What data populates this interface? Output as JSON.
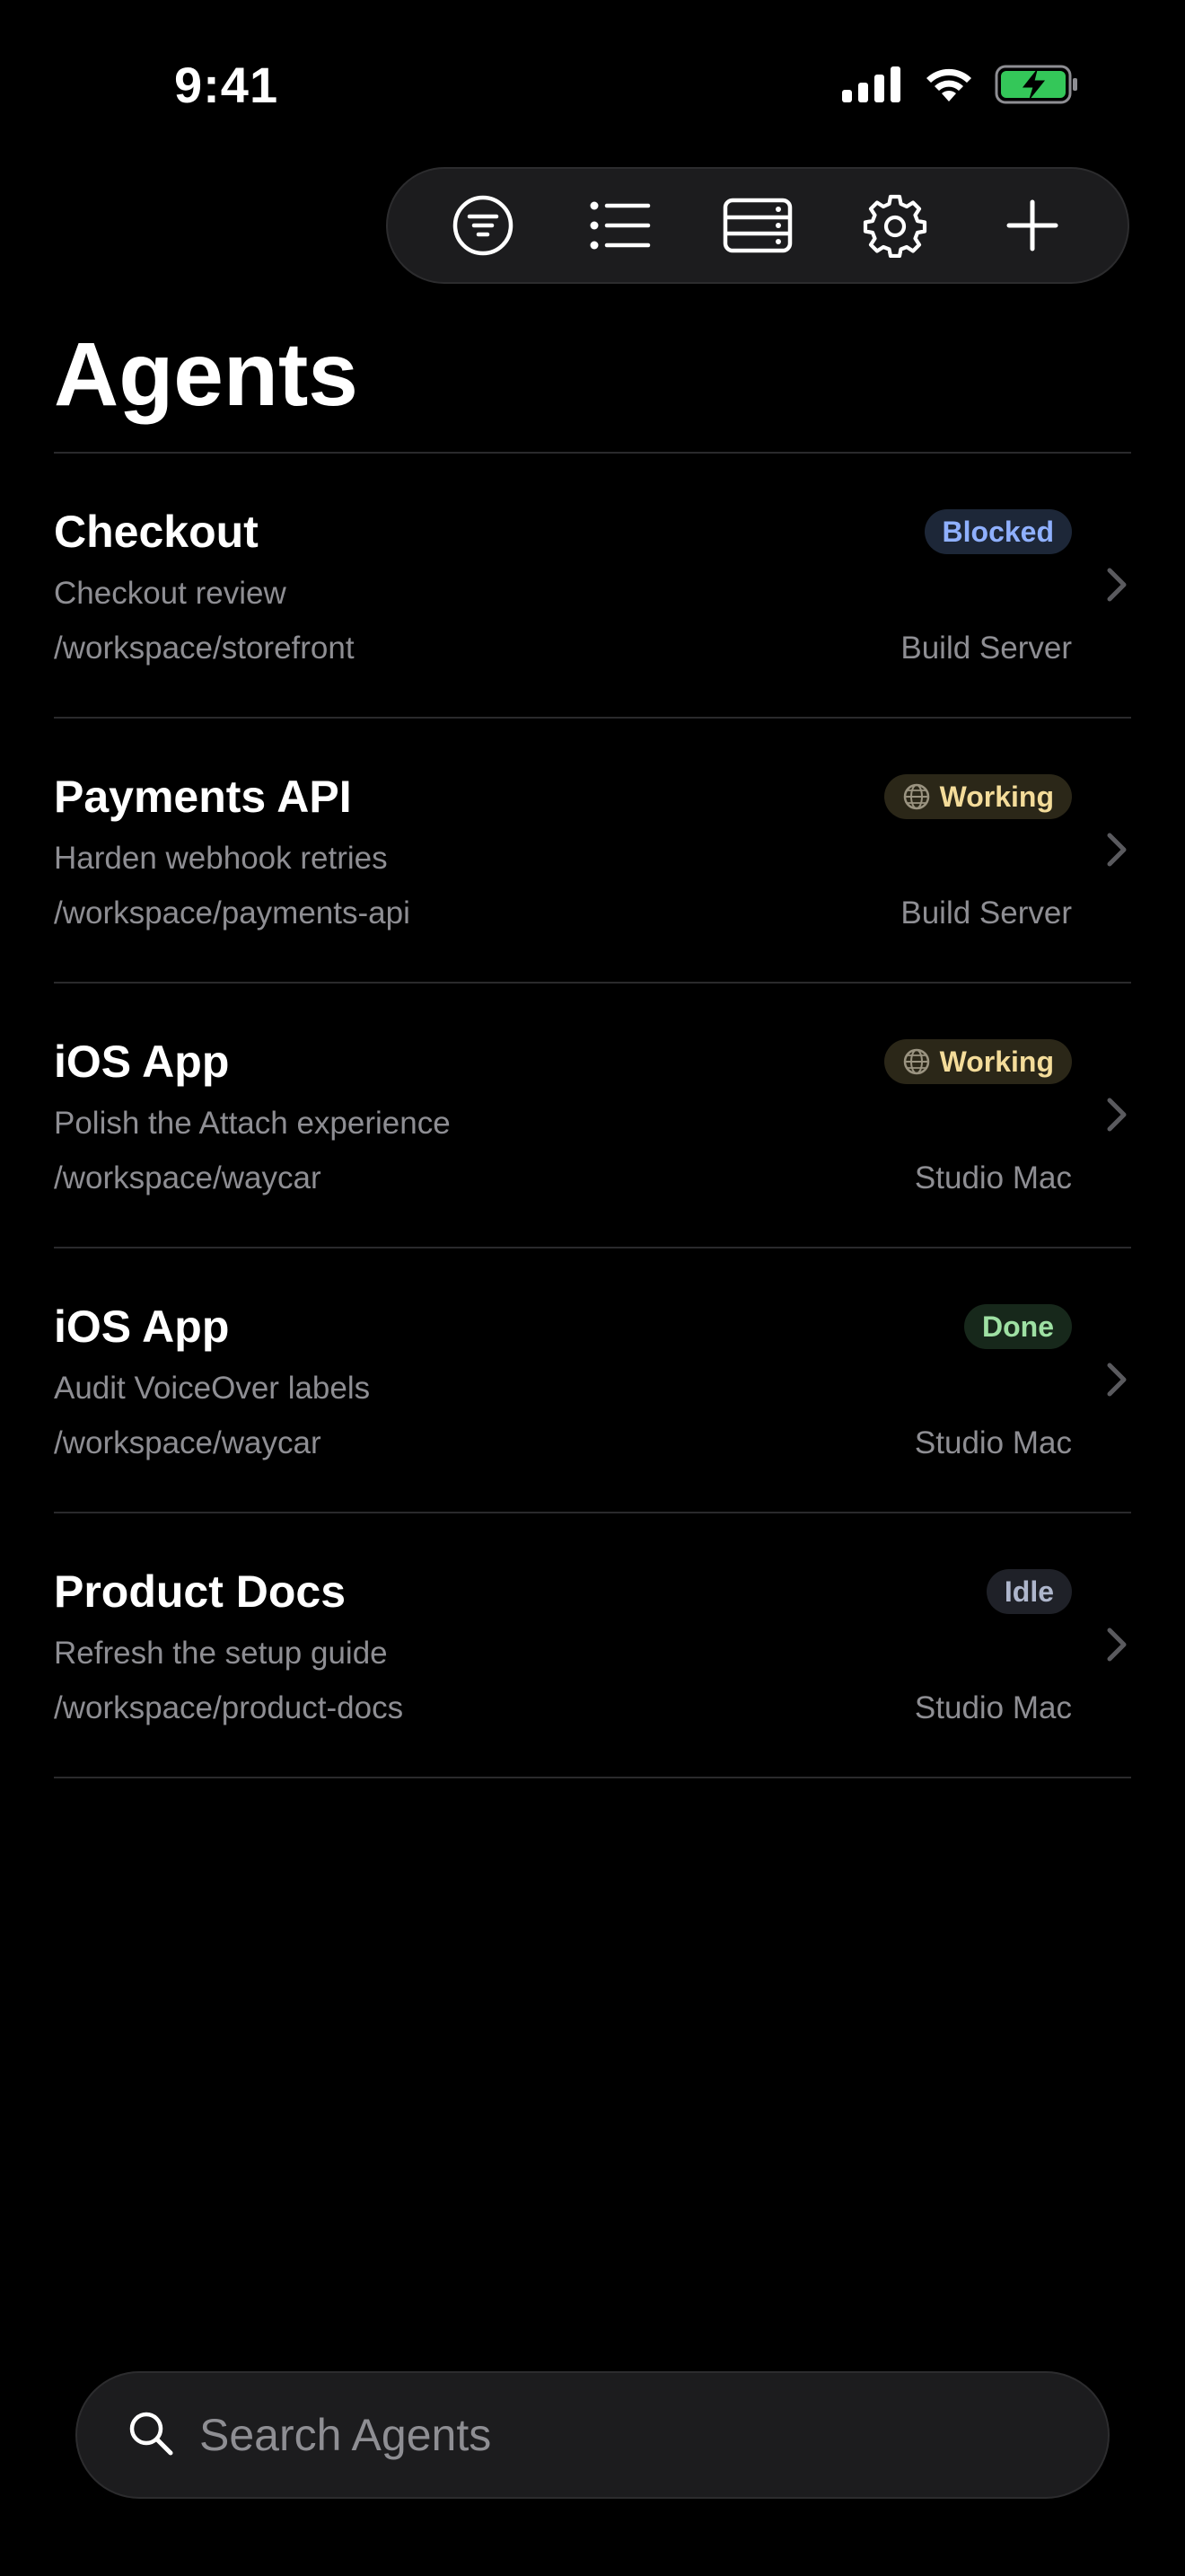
{
  "status_bar": {
    "time": "9:41",
    "icons": [
      "cellular-signal-icon",
      "wifi-icon",
      "battery-charging-icon"
    ]
  },
  "toolbar": {
    "buttons": [
      {
        "name": "filter-button",
        "icon": "filter-icon"
      },
      {
        "name": "list-button",
        "icon": "list-icon"
      },
      {
        "name": "servers-button",
        "icon": "server-icon"
      },
      {
        "name": "settings-button",
        "icon": "gear-icon"
      },
      {
        "name": "add-button",
        "icon": "plus-icon"
      }
    ]
  },
  "page": {
    "title": "Agents"
  },
  "agents": [
    {
      "name": "Checkout",
      "task": "Checkout review",
      "path": "/workspace/storefront",
      "host": "Build Server",
      "status": "Blocked",
      "status_kind": "blocked"
    },
    {
      "name": "Payments API",
      "task": "Harden webhook retries",
      "path": "/workspace/payments-api",
      "host": "Build Server",
      "status": "Working",
      "status_kind": "working"
    },
    {
      "name": "iOS App",
      "task": "Polish the Attach experience",
      "path": "/workspace/waycar",
      "host": "Studio Mac",
      "status": "Working",
      "status_kind": "working"
    },
    {
      "name": "iOS App",
      "task": "Audit VoiceOver labels",
      "path": "/workspace/waycar",
      "host": "Studio Mac",
      "status": "Done",
      "status_kind": "done"
    },
    {
      "name": "Product Docs",
      "task": "Refresh the setup guide",
      "path": "/workspace/product-docs",
      "host": "Studio Mac",
      "status": "Idle",
      "status_kind": "idle"
    }
  ],
  "search": {
    "placeholder": "Search Agents",
    "value": ""
  },
  "colors": {
    "background": "#000000",
    "secondary_text": "#8e8e93",
    "blocked": "#8fb0ff",
    "working": "#f4dc9a",
    "done": "#9ee0a3",
    "idle": "#aeb6cc",
    "battery": "#34c759"
  }
}
